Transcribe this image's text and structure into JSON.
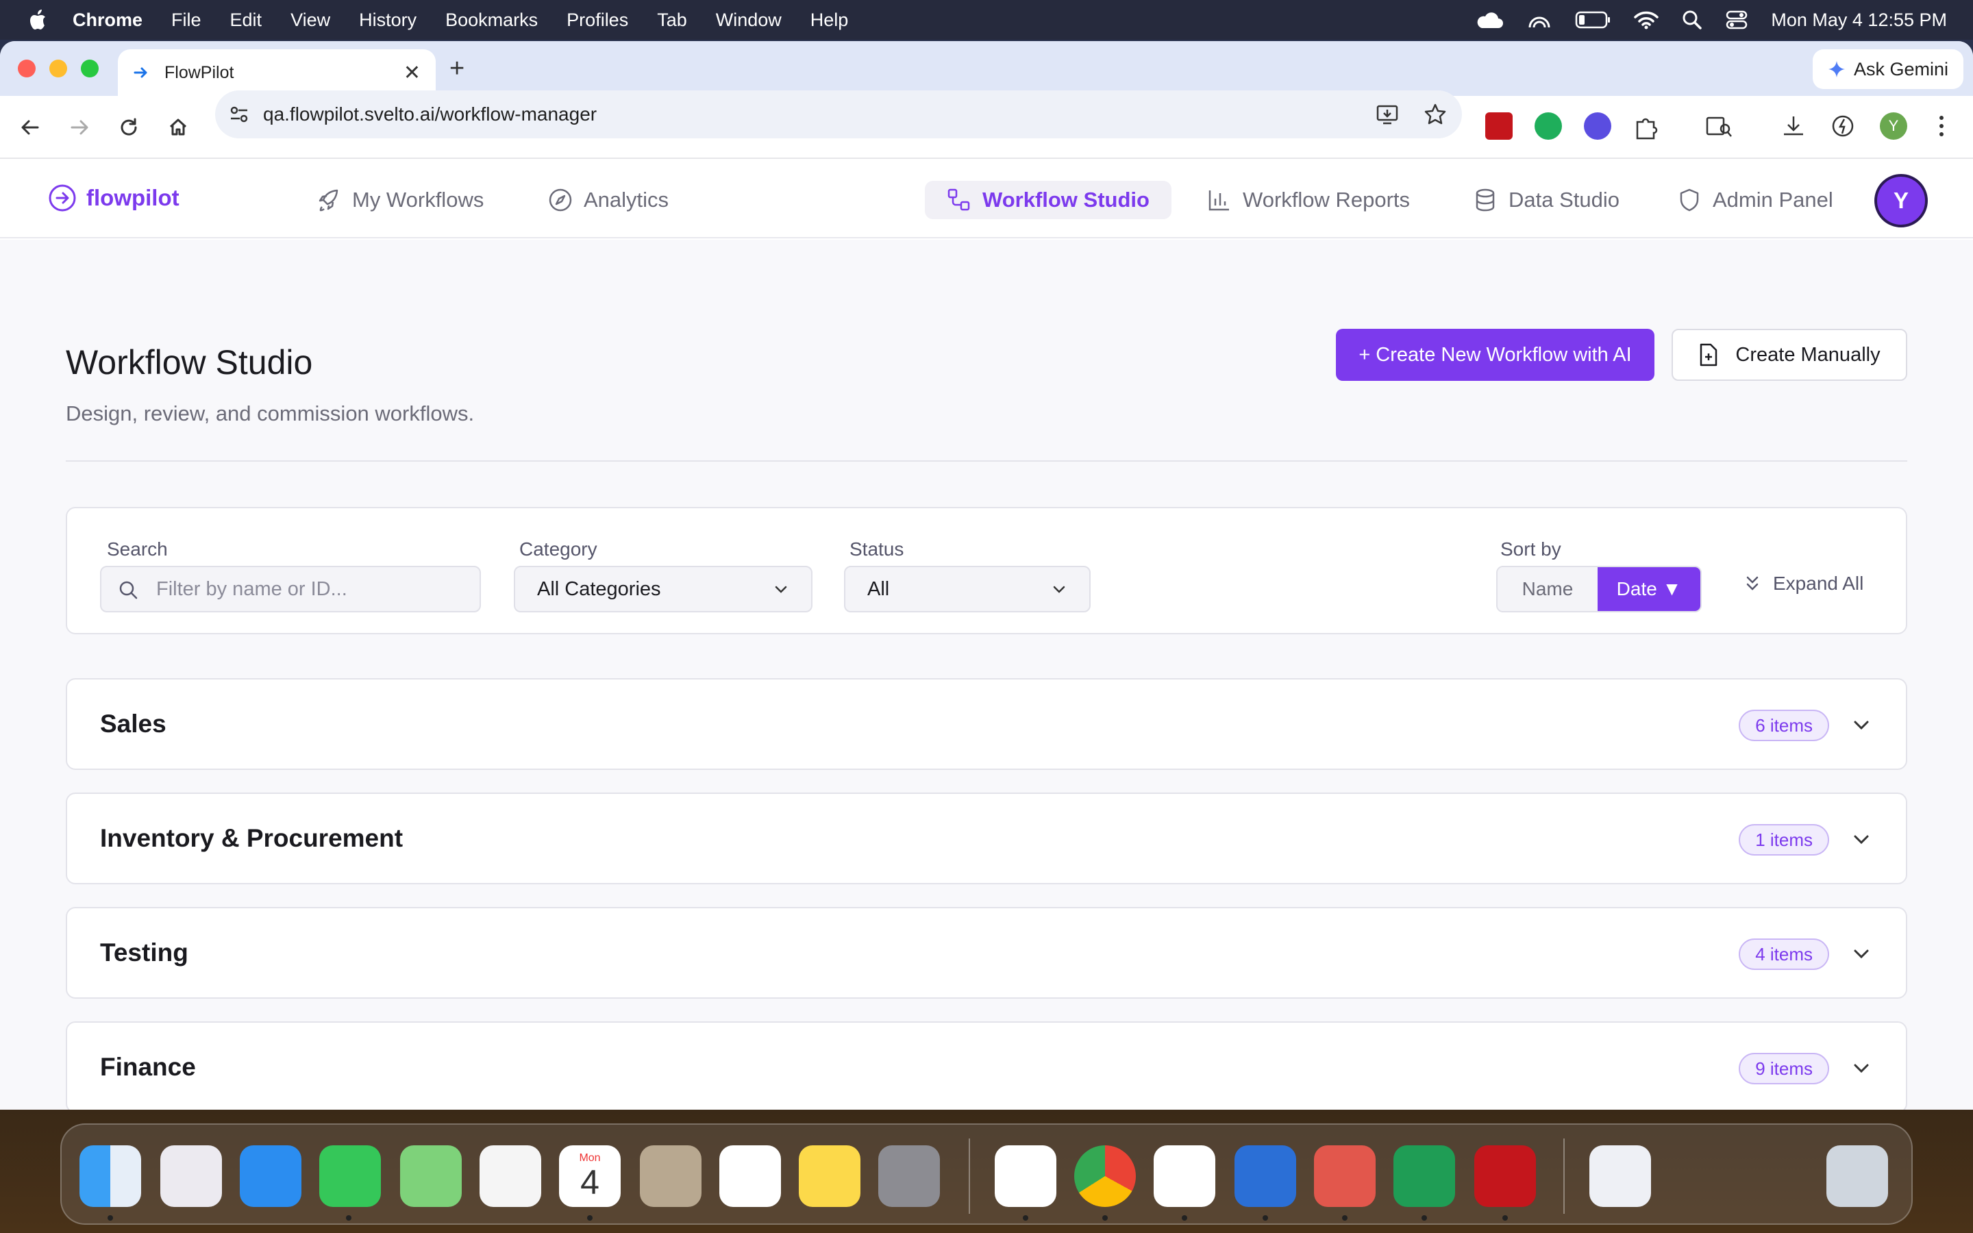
{
  "menubar": {
    "app_name": "Chrome",
    "items": [
      "File",
      "Edit",
      "View",
      "History",
      "Bookmarks",
      "Profiles",
      "Tab",
      "Window",
      "Help"
    ],
    "datetime": "Mon May 4  12:55 PM"
  },
  "browser": {
    "tab_title": "FlowPilot",
    "ask_gemini": "Ask Gemini",
    "url": "qa.flowpilot.svelto.ai/workflow-manager",
    "profile_initial": "Y"
  },
  "header": {
    "logo": "flowpilot",
    "nav": [
      {
        "label": "My Workflows",
        "icon": "rocket-icon"
      },
      {
        "label": "Analytics",
        "icon": "compass-icon"
      },
      {
        "label": "Workflow Studio",
        "icon": "nodes-icon",
        "active": true
      },
      {
        "label": "Workflow Reports",
        "icon": "bar-chart-icon"
      },
      {
        "label": "Data Studio",
        "icon": "database-icon"
      },
      {
        "label": "Admin Panel",
        "icon": "shield-icon"
      }
    ],
    "avatar_initial": "Y"
  },
  "page": {
    "title": "Workflow Studio",
    "subtitle": "Design, review, and commission workflows.",
    "create_ai_label": "+ Create New Workflow with AI",
    "create_manual_label": "Create Manually"
  },
  "filters": {
    "search_label": "Search",
    "search_placeholder": "Filter by name or ID...",
    "category_label": "Category",
    "category_value": "All Categories",
    "status_label": "Status",
    "status_value": "All",
    "sort_label": "Sort by",
    "sort_name": "Name",
    "sort_date": "Date ▼",
    "expand_all": "Expand All"
  },
  "groups": [
    {
      "name": "Sales",
      "count": "6 items"
    },
    {
      "name": "Inventory & Procurement",
      "count": "1 items"
    },
    {
      "name": "Testing",
      "count": "4 items"
    },
    {
      "name": "Finance",
      "count": "9 items"
    }
  ],
  "colors": {
    "accent": "#7c3aed",
    "badge_bg": "#f1ecfd"
  },
  "dock": {
    "calendar_month": "Mon",
    "calendar_day": "4",
    "apps": [
      "finder-icon",
      "launchpad-icon",
      "safari-icon",
      "messages-icon",
      "maps-icon",
      "photos-icon",
      "calendar-icon",
      "contacts-icon",
      "reminders-icon",
      "notes-icon",
      "settings-icon",
      "app-icon",
      "chrome-icon",
      "slack-icon",
      "word-icon",
      "powerpoint-icon",
      "excel-icon",
      "acrobat-icon",
      "document-icon",
      "trash-icon"
    ]
  }
}
